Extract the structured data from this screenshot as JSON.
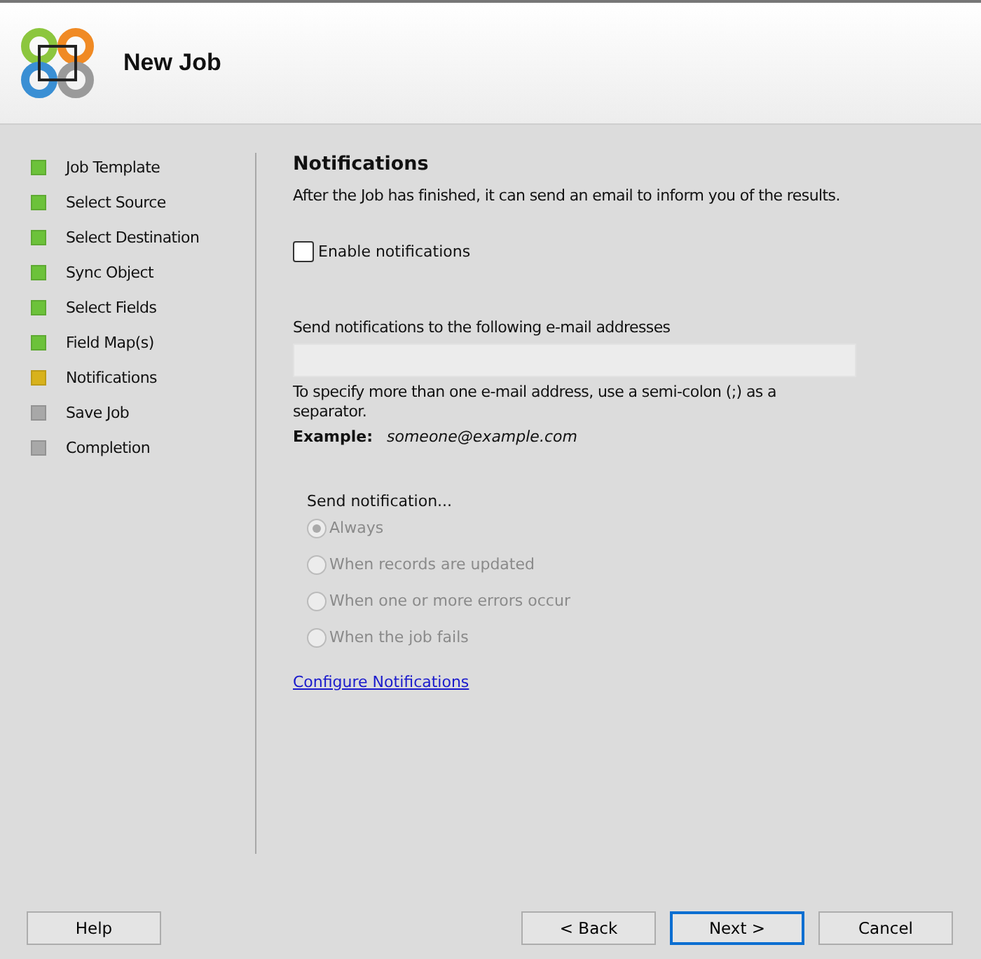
{
  "header": {
    "title": "New Job"
  },
  "steps": [
    {
      "label": "Job Template",
      "kind": "done"
    },
    {
      "label": "Select Source",
      "kind": "done"
    },
    {
      "label": "Select Destination",
      "kind": "done"
    },
    {
      "label": "Sync Object",
      "kind": "done"
    },
    {
      "label": "Select Fields",
      "kind": "done"
    },
    {
      "label": "Field Map(s)",
      "kind": "done"
    },
    {
      "label": "Notifications",
      "kind": "current"
    },
    {
      "label": "Save Job",
      "kind": "pending"
    },
    {
      "label": "Completion",
      "kind": "pending"
    }
  ],
  "panel": {
    "heading": "Notifications",
    "intro": "After the Job has finished, it can send an email to inform you of the results.",
    "enable": {
      "label": "Enable notifications",
      "checked": false
    },
    "email_label": "Send notifications to the following e-mail addresses",
    "email_field": {
      "disabled": true
    },
    "hint": "To specify more than one e-mail address, use a semi-colon (;) as a separator.",
    "example_label": "Example:",
    "example_value": "someone@example.com",
    "send_label": "Send notification...",
    "options": [
      {
        "label": "Always",
        "selected": true,
        "disabled": true
      },
      {
        "label": "When records are updated",
        "selected": false,
        "disabled": true
      },
      {
        "label": "When one or more errors occur",
        "selected": false,
        "disabled": true
      },
      {
        "label": "When the job fails",
        "selected": false,
        "disabled": true
      }
    ],
    "link": "Configure Notifications"
  },
  "buttons": {
    "help": "Help",
    "back": "< Back",
    "next": "Next >",
    "cancel": "Cancel"
  }
}
